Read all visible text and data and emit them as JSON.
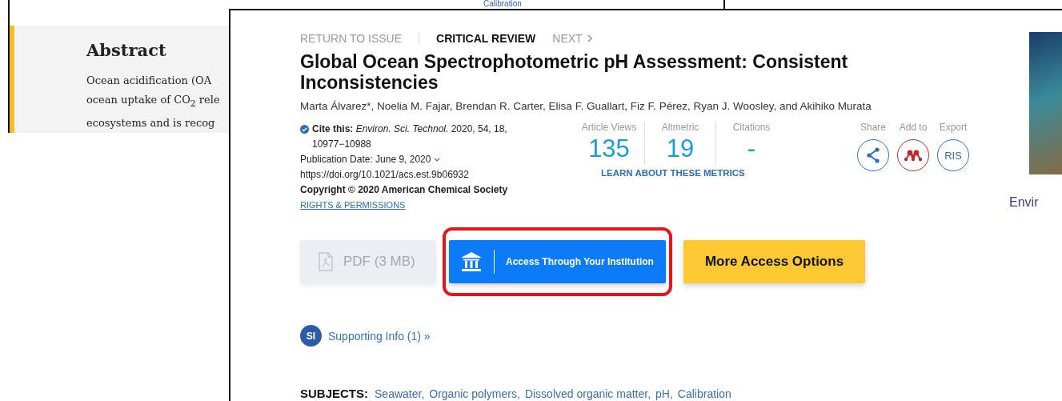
{
  "background_page": {
    "top_link": "Calibration",
    "abstract": {
      "heading": "Abstract",
      "lines": [
        "Ocean acidification (OA",
        "ocean uptake of CO$_{2}$ rele",
        "ecosystems and is recog"
      ]
    }
  },
  "article": {
    "nav": [
      {
        "label": "RETURN TO ISSUE",
        "kind": "link"
      },
      {
        "label": "CRITICAL REVIEW",
        "kind": "type"
      },
      {
        "label": "NEXT",
        "kind": "next"
      }
    ],
    "title": "Global Ocean Spectrophotometric pH Assessment: Consistent Inconsistencies",
    "authors": "Marta Álvarez*, Noelia M. Fajar, Brendan R. Carter, Elisa F. Guallart, Fiz F. Pérez, Ryan J. Woosley, and Akihiko Murata",
    "citation": "**Cite this:** *Environ. Sci. Technol.*  2020, 54, 18, 10977−10988",
    "publication_date": "Publication Date: June 9, 2020",
    "doi": "https://doi.org/10.1021/acs.est.9b06932",
    "copyright": "Copyright © 2020 American Chemical Society",
    "rights_link": "RIGHTS & PERMISSIONS",
    "metrics": [
      {
        "label": "Article Views",
        "value": "135"
      },
      {
        "label": "Altmetric",
        "value": "19"
      },
      {
        "label": "Citations",
        "value": "-"
      }
    ],
    "metrics_link": "LEARN ABOUT THESE METRICS",
    "actions": [
      {
        "label": "Share",
        "kind": "share"
      },
      {
        "label": "Add to",
        "kind": "mendeley"
      },
      {
        "label": "Export",
        "kind": "ris",
        "text": "RIS"
      }
    ],
    "buttons": [
      {
        "label": "PDF (3 MB)",
        "kind": "pdf",
        "disabled": true,
        "highlighted": false
      },
      {
        "label": "Access Through Your Institution",
        "kind": "institution",
        "disabled": false,
        "highlighted": true
      },
      {
        "label": "More Access Options",
        "kind": "more",
        "disabled": false,
        "highlighted": false
      }
    ],
    "supporting_info": {
      "badge": "SI",
      "label": "Supporting Info (1) »"
    },
    "subjects": {
      "label": "SUBJECTS:",
      "items": [
        "Seawater,",
        "Organic polymers,",
        "Dissolved organic matter,",
        "pH,",
        "Calibration"
      ]
    },
    "journal_caption": "Envir"
  }
}
